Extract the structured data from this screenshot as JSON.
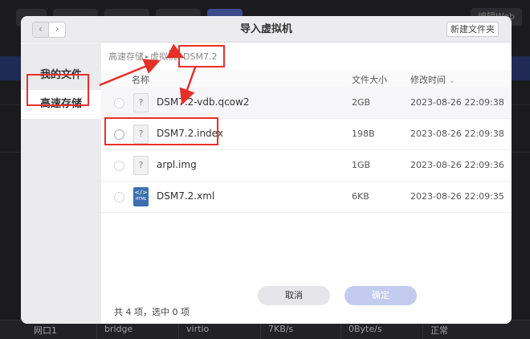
{
  "background": {
    "top_right_label": "编辑Web",
    "bottom_row": [
      "网口1",
      "bridge",
      "virtio",
      "7KB/s",
      "0Byte/s",
      "正常"
    ]
  },
  "dialog": {
    "title": "导入虚拟机",
    "back_icon": "chevron-left-icon",
    "forward_icon": "chevron-right-icon",
    "new_folder_label": "新建文件夹",
    "sidebar": {
      "items": [
        {
          "label": "我的文件",
          "selected": false
        },
        {
          "label": "高速存储",
          "selected": true
        }
      ]
    },
    "breadcrumb": [
      "高速存储",
      "虚拟机",
      "DSM7.2"
    ],
    "columns": {
      "name": "名称",
      "size": "文件大小",
      "modified": "修改时间",
      "sort_icon": "chevron-down-icon"
    },
    "files": [
      {
        "name": "DSM7.2-vdb.qcow2",
        "size": "2GB",
        "modified": "2023-08-26 22:09:38",
        "icon": "unknown-file-icon"
      },
      {
        "name": "DSM7.2.index",
        "size": "198B",
        "modified": "2023-08-26 22:09:38",
        "icon": "unknown-file-icon"
      },
      {
        "name": "arpl.img",
        "size": "1GB",
        "modified": "2023-08-26 22:09:36",
        "icon": "unknown-file-icon"
      },
      {
        "name": "DSM7.2.xml",
        "size": "6KB",
        "modified": "2023-08-26 22:09:35",
        "icon": "html-file-icon"
      }
    ],
    "status": "共 4 项，选中 0 项",
    "cancel_label": "取消",
    "ok_label": "确定"
  },
  "colors": {
    "accent": "#e5302a",
    "primary_disabled": "#c3cbef"
  }
}
